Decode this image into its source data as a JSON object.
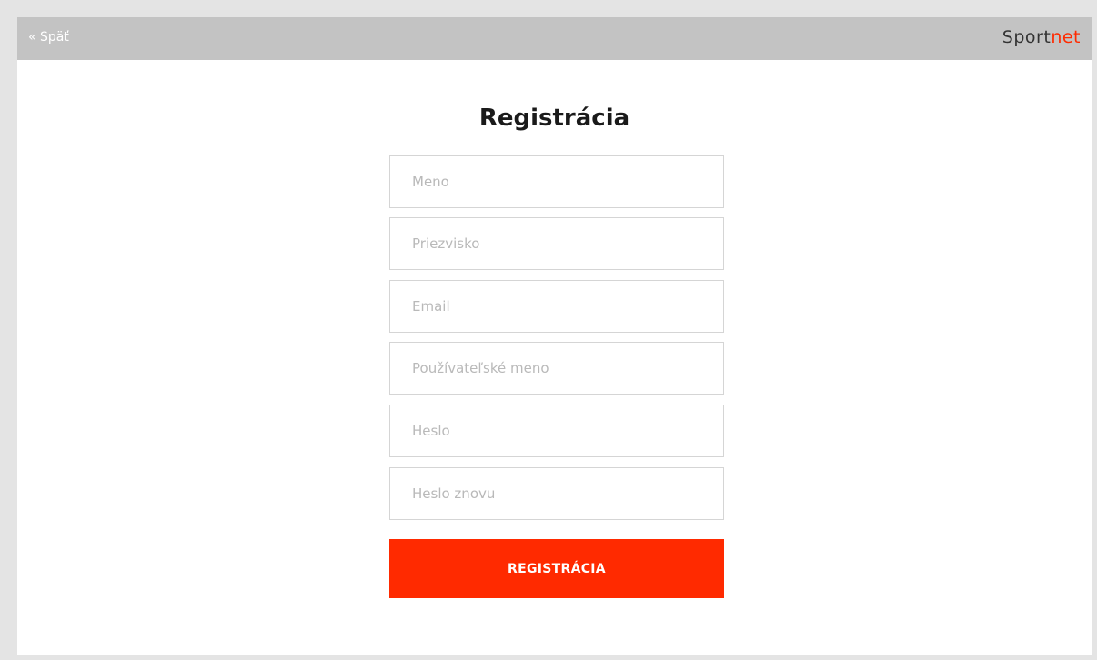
{
  "header": {
    "back_label": "« Späť",
    "logo": {
      "part1": "Sport",
      "part2": "net",
      "part1_color": "#333333",
      "part2_color": "#ff2a00"
    }
  },
  "form": {
    "title": "Registrácia",
    "fields": [
      {
        "name": "first-name",
        "placeholder": "Meno",
        "value": ""
      },
      {
        "name": "last-name",
        "placeholder": "Priezvisko",
        "value": ""
      },
      {
        "name": "email",
        "placeholder": "Email",
        "value": ""
      },
      {
        "name": "username",
        "placeholder": "Používateľské meno",
        "value": ""
      },
      {
        "name": "password",
        "placeholder": "Heslo",
        "value": ""
      },
      {
        "name": "password-repeat",
        "placeholder": "Heslo znovu",
        "value": ""
      }
    ],
    "submit_label": "REGISTRÁCIA",
    "accent_color": "#ff2a00"
  }
}
